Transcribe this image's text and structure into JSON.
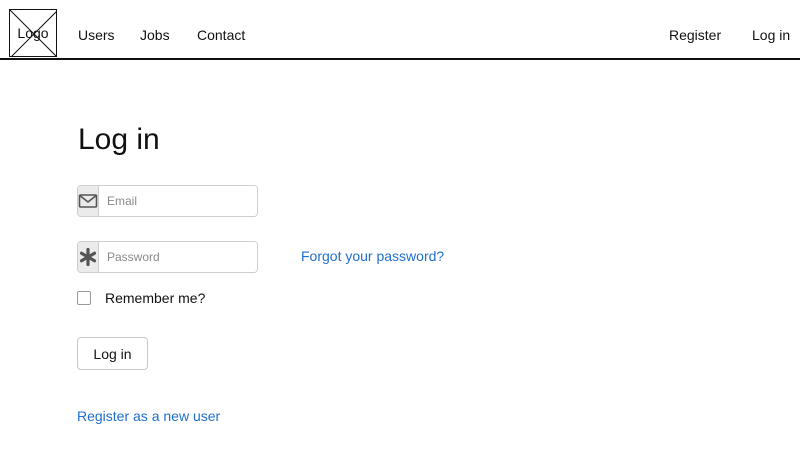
{
  "nav": {
    "logo_text": "Logo",
    "links": {
      "users": "Users",
      "jobs": "Jobs",
      "contact": "Contact",
      "register": "Register",
      "login": "Log in"
    }
  },
  "login_form": {
    "title": "Log in",
    "email": {
      "icon": "envelope-icon",
      "placeholder": "Email",
      "value": ""
    },
    "password": {
      "icon": "asterisk-icon",
      "placeholder": "Password",
      "value": ""
    },
    "forgot_password": "Forgot your password?",
    "remember_me": {
      "label": "Remember me?",
      "checked": false
    },
    "submit_label": "Log in",
    "register_link": "Register as a new user"
  },
  "colors": {
    "link": "#1f6fcf",
    "text": "#111111",
    "addon_bg": "#ebebeb",
    "border": "#cfcfcf"
  }
}
